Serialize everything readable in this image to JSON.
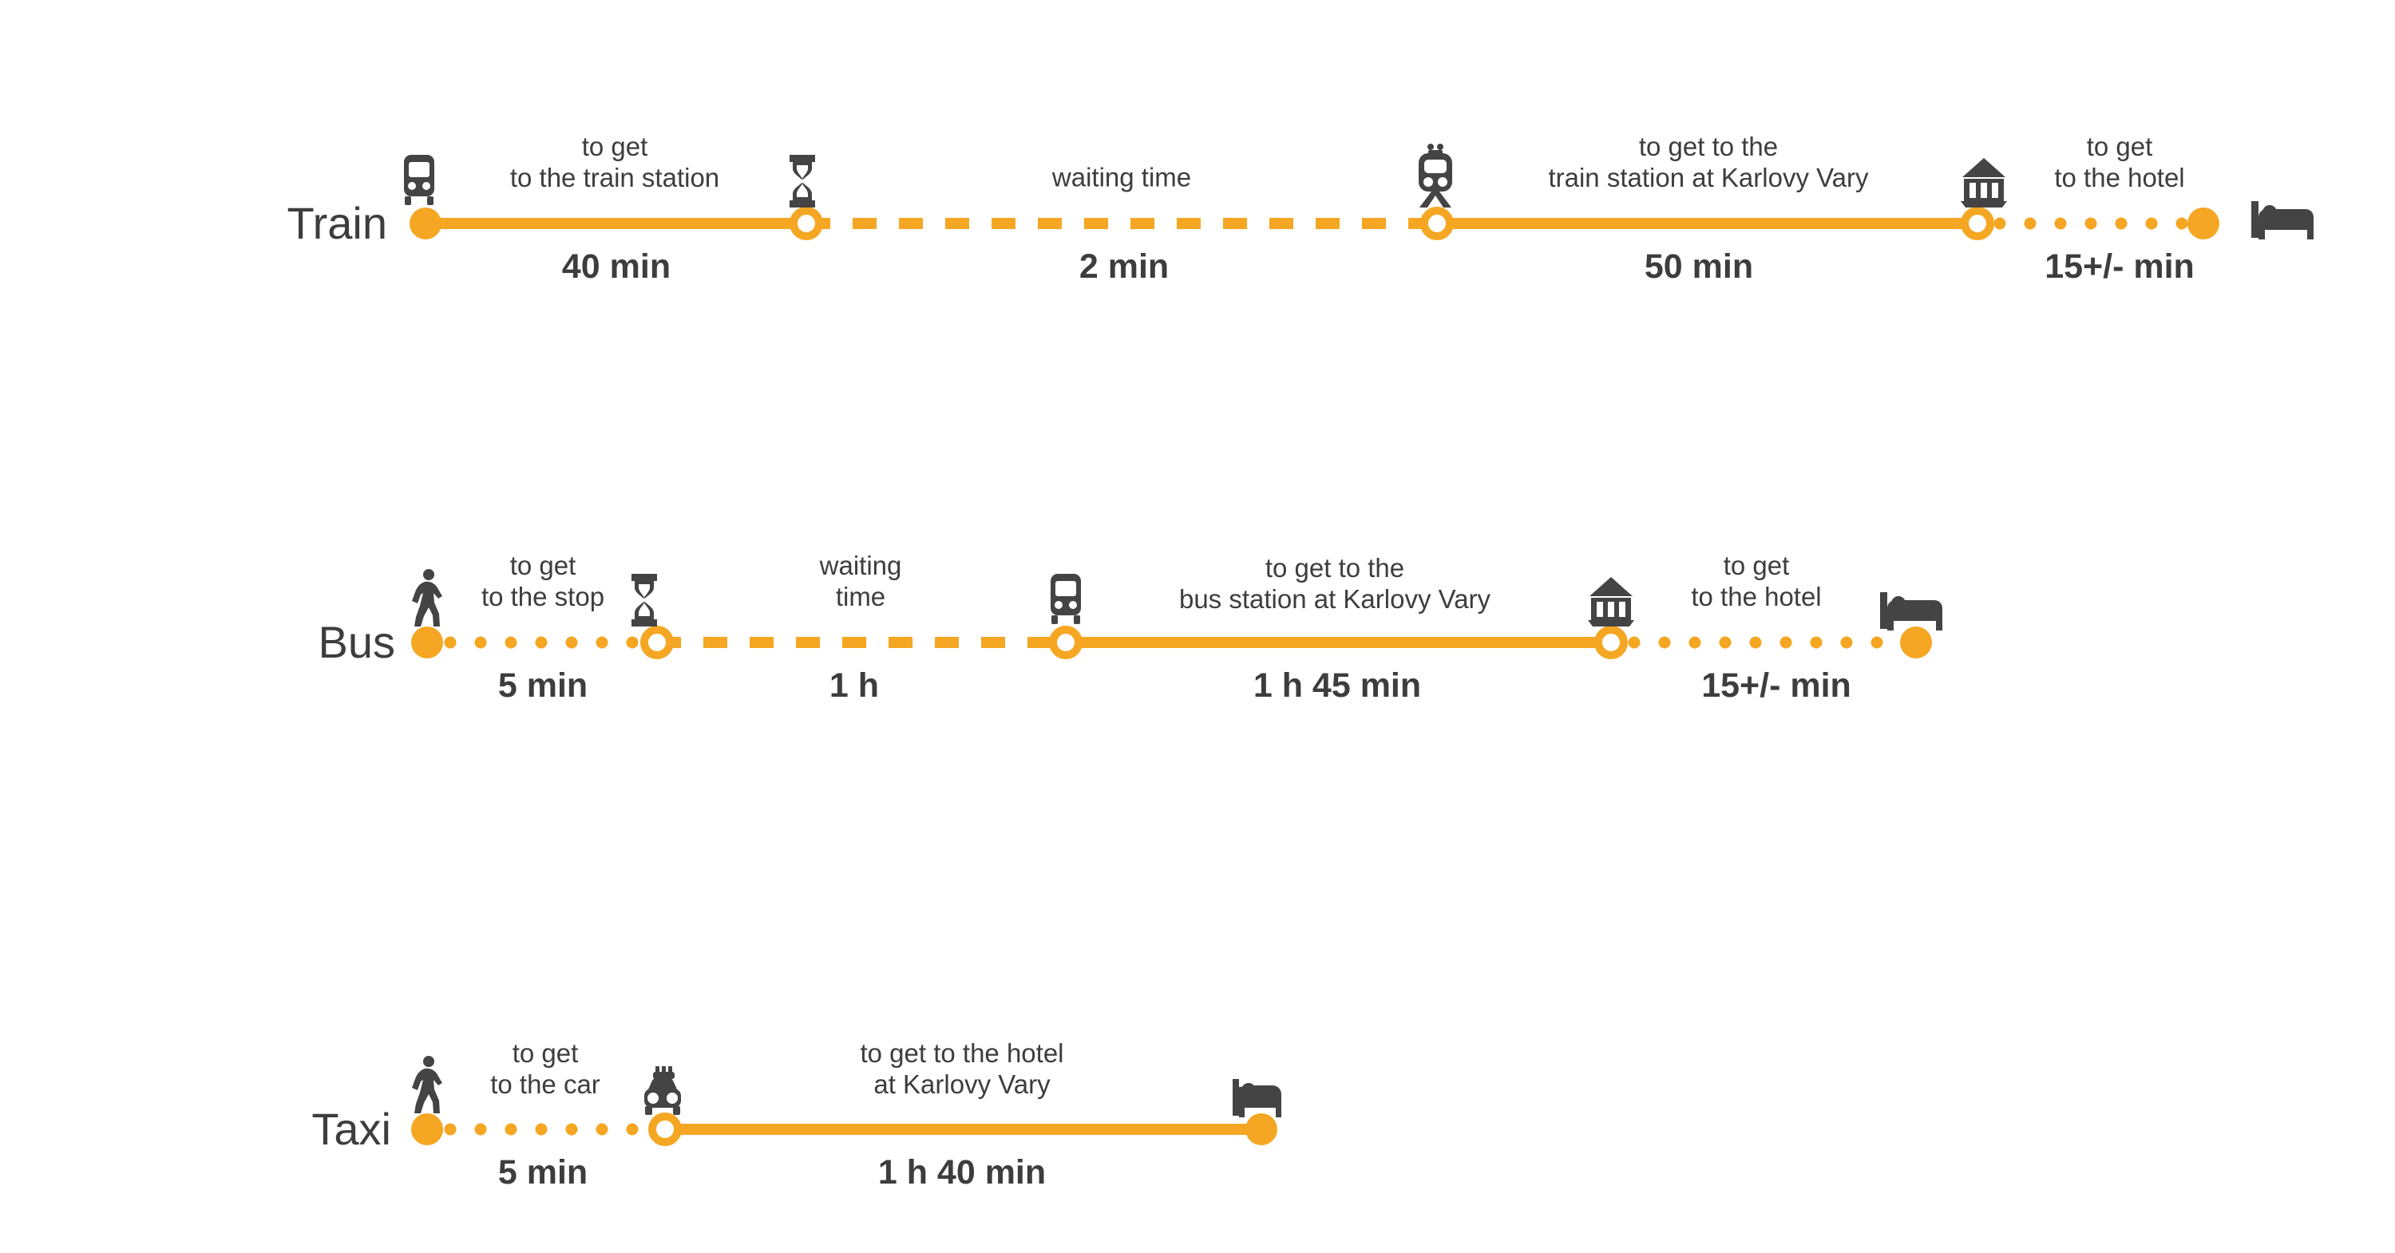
{
  "theme": {
    "accent": "#f5a623",
    "ink": "#3d3d3d",
    "icon": "#444444",
    "background": "#ffffff"
  },
  "chart_data": {
    "type": "timeline",
    "title": "",
    "routes": [
      {
        "mode": "Train",
        "label": "Train",
        "segments": [
          {
            "description": "to get\nto the train station",
            "duration": "40 min",
            "style": "solid",
            "start_icon": "bus-icon",
            "end_icon": "hourglass-icon"
          },
          {
            "description": "waiting time",
            "duration": "2 min",
            "style": "dashed",
            "start_icon": "hourglass-icon",
            "end_icon": "train-icon"
          },
          {
            "description": "to get to the\ntrain station at Karlovy Vary",
            "duration": "50 min",
            "style": "solid",
            "start_icon": "train-icon",
            "end_icon": "bank-icon"
          },
          {
            "description": "to get\nto the hotel",
            "duration": "15+/- min",
            "style": "dotted",
            "start_icon": "bank-icon",
            "end_icon": "hotel-bed-icon"
          }
        ]
      },
      {
        "mode": "Bus",
        "label": "Bus",
        "segments": [
          {
            "description": "to get\nto the stop",
            "duration": "5 min",
            "style": "dotted",
            "start_icon": "walking-icon",
            "end_icon": "hourglass-icon"
          },
          {
            "description": "waiting\ntime",
            "duration": "1 h",
            "style": "dashed",
            "start_icon": "hourglass-icon",
            "end_icon": "bus-icon"
          },
          {
            "description": "to get to the\nbus station at Karlovy Vary",
            "duration": "1 h 45 min",
            "style": "solid",
            "start_icon": "bus-icon",
            "end_icon": "bank-icon"
          },
          {
            "description": "to get\nto the hotel",
            "duration": "15+/- min",
            "style": "dotted",
            "start_icon": "bank-icon",
            "end_icon": "hotel-bed-icon"
          }
        ]
      },
      {
        "mode": "Taxi",
        "label": "Taxi",
        "segments": [
          {
            "description": "to get\nto the car",
            "duration": "5 min",
            "style": "dotted",
            "start_icon": "walking-icon",
            "end_icon": "taxi-icon"
          },
          {
            "description": "to get to the hotel\nat Karlovy Vary",
            "duration": "1 h 40 min",
            "style": "solid",
            "start_icon": "taxi-icon",
            "end_icon": "hotel-bed-icon"
          }
        ]
      }
    ]
  },
  "rows": {
    "train": {
      "label": "Train",
      "segments": [
        {
          "description": "to get\nto the train station",
          "duration": "40 min"
        },
        {
          "description": "waiting time",
          "duration": "2 min"
        },
        {
          "description": "to get to the\ntrain station at Karlovy Vary",
          "duration": "50 min"
        },
        {
          "description": "to get\nto the hotel",
          "duration": "15+/- min"
        }
      ]
    },
    "bus": {
      "label": "Bus",
      "segments": [
        {
          "description": "to get\nto the stop",
          "duration": "5 min"
        },
        {
          "description": "waiting\ntime",
          "duration": "1 h"
        },
        {
          "description": "to get to the\nbus station at Karlovy Vary",
          "duration": "1 h 45 min"
        },
        {
          "description": "to get\nto the hotel",
          "duration": "15+/- min"
        }
      ]
    },
    "taxi": {
      "label": "Taxi",
      "segments": [
        {
          "description": "to get\nto the car",
          "duration": "5 min"
        },
        {
          "description": "to get to the hotel\nat Karlovy Vary",
          "duration": "1 h 40 min"
        }
      ]
    }
  }
}
